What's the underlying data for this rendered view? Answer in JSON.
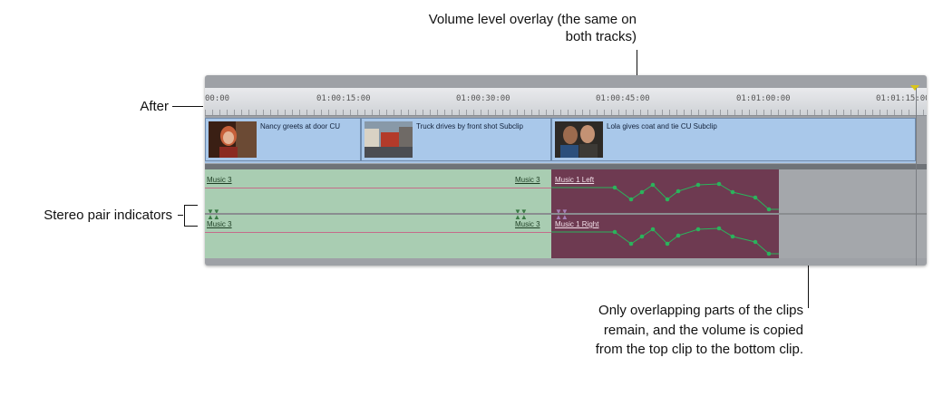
{
  "annotations": {
    "volume_overlay": "Volume level overlay (the same on both tracks)",
    "after": "After",
    "stereo_pair": "Stereo pair indicators",
    "overlap_note": "Only overlapping parts of the clips remain, and the volume is copied from the top clip to the bottom clip."
  },
  "ruler": {
    "timecodes": [
      "00:00",
      "01:00:15:00",
      "01:00:30:00",
      "01:00:45:00",
      "01:01:00:00",
      "01:01:15:00"
    ]
  },
  "video_clips": [
    {
      "label": "Nancy greets at door CU"
    },
    {
      "label": "Truck drives by front shot Subclip"
    },
    {
      "label": "Lola gives coat and tie CU Subclip"
    }
  ],
  "audio": {
    "left_green_top": "Music 3",
    "right_green_top": "Music 3",
    "left_green_bottom": "Music 3",
    "right_green_bottom": "Music 3",
    "maroon_top": "Music 1 Left",
    "maroon_bottom": "Music 1 Right"
  },
  "colors": {
    "video_clip": "#a9c8ea",
    "audio_green": "#a9cdb2",
    "audio_maroon": "#6e3a51",
    "keyframe": "#2bb35c"
  },
  "icons": {
    "stereo_indicator": "stereo-pair-triangles",
    "playhead": "playhead-marker"
  }
}
